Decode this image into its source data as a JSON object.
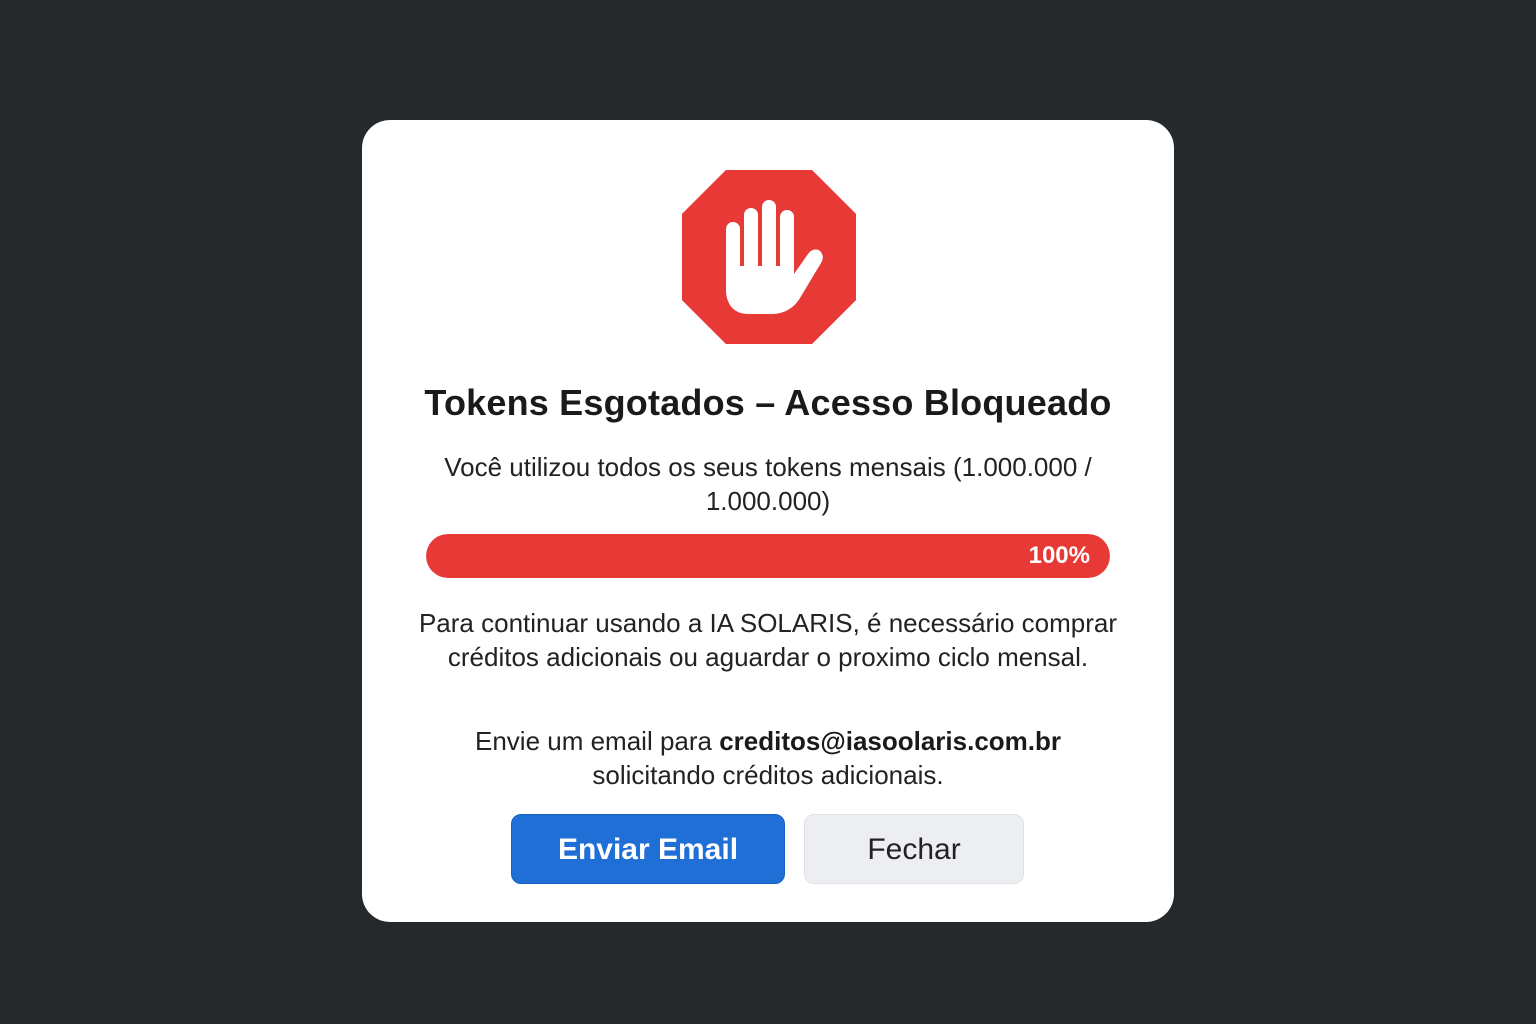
{
  "modal": {
    "icon": "stop-hand-icon",
    "title": "Tokens Esgotados – Acesso Bloqueado",
    "usage_text": "Você utilizou todos os seus tokens mensais (1.000.000 / 1.000.000)",
    "progress": {
      "percent": 100,
      "label": "100%"
    },
    "info_text": "Para continuar usando a IA SOLARIS, é necessário comprar créditos adicionais ou aguardar o proximo ciclo mensal.",
    "email_prefix": "Envie um email para ",
    "email_address": "creditos@iasoolaris.com.br",
    "email_suffix": " solicitando créditos adicionais.",
    "buttons": {
      "send_email": "Enviar Email",
      "close": "Fechar"
    }
  },
  "colors": {
    "background": "#26292c",
    "danger": "#e73a37",
    "primary": "#1f6fd6",
    "secondary": "#eceef1"
  }
}
